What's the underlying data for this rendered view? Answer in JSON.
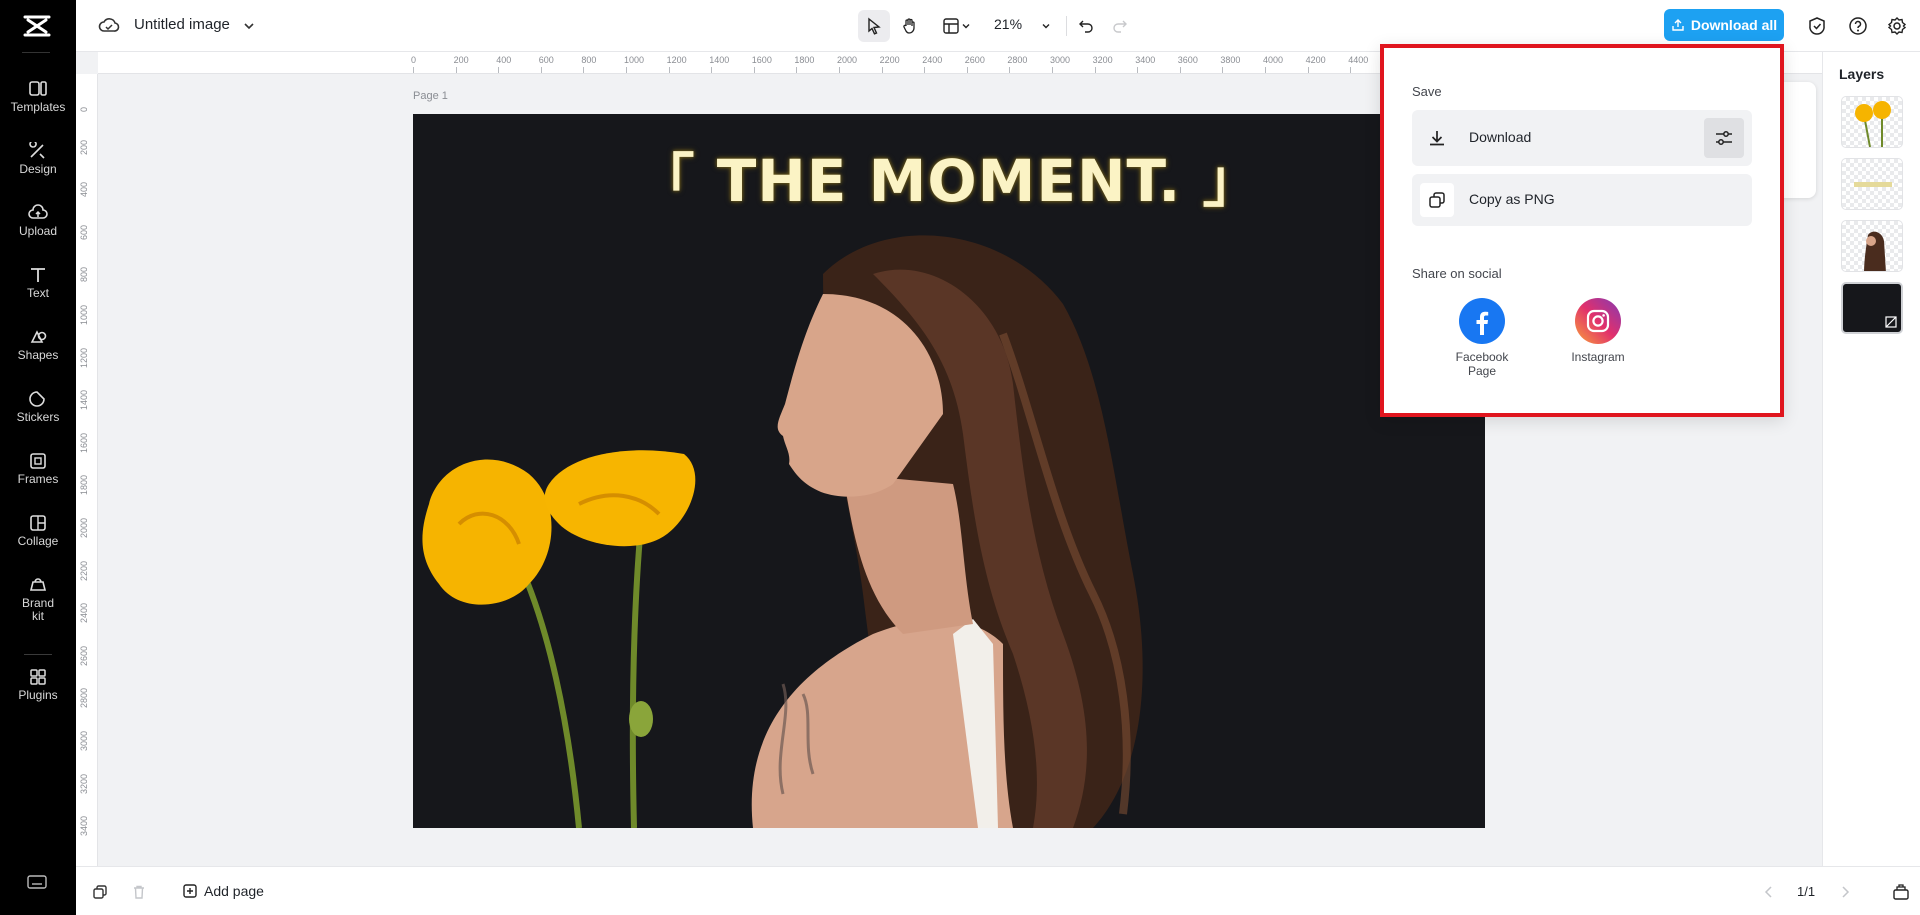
{
  "app": {
    "document_title": "Untitled image"
  },
  "sidebar": {
    "items": [
      {
        "label": "Templates"
      },
      {
        "label": "Design"
      },
      {
        "label": "Upload"
      },
      {
        "label": "Text"
      },
      {
        "label": "Shapes"
      },
      {
        "label": "Stickers"
      },
      {
        "label": "Frames"
      },
      {
        "label": "Collage"
      },
      {
        "label": "Brand kit"
      },
      {
        "label": "Plugins"
      }
    ]
  },
  "toolbar": {
    "zoom": "21%",
    "download_all_label": "Download all"
  },
  "ruler": {
    "top_ticks": [
      "0",
      "200",
      "400",
      "600",
      "800",
      "1000",
      "1200",
      "1400",
      "1600",
      "1800",
      "2000",
      "2200",
      "2400",
      "2600",
      "2800",
      "3000",
      "3200",
      "3400",
      "3600",
      "3800",
      "4000",
      "4200",
      "4400"
    ],
    "left_ticks": [
      "0",
      "200",
      "400",
      "600",
      "800",
      "1000",
      "1200",
      "1400",
      "1600",
      "1800",
      "2000",
      "2200",
      "2400",
      "2600",
      "2800",
      "3000",
      "3200",
      "3400"
    ]
  },
  "canvas": {
    "page_label": "Page 1",
    "headline": "「 THE MOMENT. 」",
    "background_color": "#16171b"
  },
  "layers": {
    "title": "Layers"
  },
  "popover": {
    "save_heading": "Save",
    "download_label": "Download",
    "copy_label": "Copy as PNG",
    "share_heading": "Share on social",
    "facebook_label": "Facebook Page",
    "instagram_label": "Instagram"
  },
  "bottombar": {
    "add_page_label": "Add page",
    "page_count": "1/1"
  },
  "colors": {
    "accent": "#1da1f2",
    "highlight_border": "#e0151e",
    "facebook": "#1877f2"
  }
}
